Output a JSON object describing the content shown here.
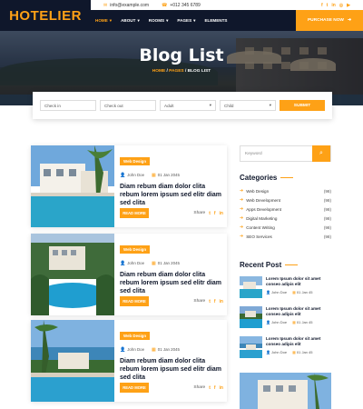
{
  "brand": "HOTELIER",
  "contact": {
    "email": "info@example.com",
    "phone": "+012 345 6789",
    "social_icons": [
      "facebook-icon",
      "twitter-icon",
      "linkedin-icon",
      "instagram-icon",
      "youtube-icon"
    ]
  },
  "nav": {
    "items": [
      "HOME",
      "ABOUT",
      "ROOMS",
      "PAGES",
      "ELEMENTS"
    ],
    "purchase_label": "PURCHASE NOW"
  },
  "hero": {
    "title": "Blog List",
    "breadcrumb": [
      "HOME",
      "PAGES",
      "BLOG LIST"
    ]
  },
  "search": {
    "checkin": "Check in",
    "checkout": "Check out",
    "adult": "Adult",
    "child": "Child",
    "submit": "SUBMIT"
  },
  "posts": [
    {
      "tag": "Web Design",
      "author": "John Doe",
      "date": "01 Jan 2045",
      "title": "Diam rebum diam dolor clita rebum lorem ipsum sed elitr diam sed clita",
      "read_more": "READ MORE",
      "share": "Share"
    },
    {
      "tag": "Web Design",
      "author": "John Doe",
      "date": "01 Jan 2045",
      "title": "Diam rebum diam dolor clita rebum lorem ipsum sed elitr diam sed clita",
      "read_more": "READ MORE",
      "share": "Share"
    },
    {
      "tag": "Web Design",
      "author": "John Doe",
      "date": "01 Jan 2045",
      "title": "Diam rebum diam dolor clita rebum lorem ipsum sed elitr diam sed clita",
      "read_more": "READ MORE",
      "share": "Share"
    }
  ],
  "sidebar": {
    "keyword_placeholder": "Keyword",
    "categories_heading": "Categories",
    "categories": [
      {
        "label": "Web Design",
        "count": "(98)"
      },
      {
        "label": "Web Development",
        "count": "(98)"
      },
      {
        "label": "Apps Development",
        "count": "(98)"
      },
      {
        "label": "Digital Marketing",
        "count": "(98)"
      },
      {
        "label": "Content Writing",
        "count": "(98)"
      },
      {
        "label": "SEO Services",
        "count": "(98)"
      }
    ],
    "recent_heading": "Recent Post",
    "recent": [
      {
        "title": "Lorem Ipsum dolor sit amet conseo adipis elit",
        "author": "John Doe",
        "date": "01 Jan 45"
      },
      {
        "title": "Lorem Ipsum dolor sit amet conseo adipis elit",
        "author": "John Doe",
        "date": "01 Jan 45"
      },
      {
        "title": "Lorem Ipsum dolor sit amet conseo adipis elit",
        "author": "John Doe",
        "date": "01 Jan 45"
      }
    ]
  },
  "colors": {
    "accent": "#fea116",
    "dark": "#0f172b"
  }
}
